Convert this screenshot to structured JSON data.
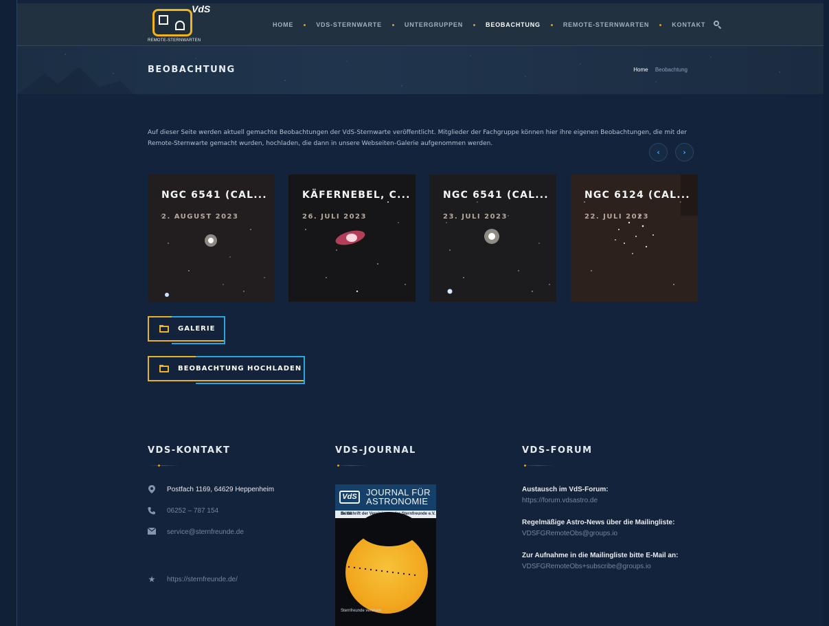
{
  "header": {
    "logo_brand": "VdS",
    "logo_text": "REMOTE-STERNWARTEN",
    "nav": [
      {
        "label": "HOME",
        "active": false
      },
      {
        "label": "VDS-STERNWARTE",
        "active": false
      },
      {
        "label": "UNTERGRUPPEN",
        "active": false
      },
      {
        "label": "BEOBACHTUNG",
        "active": true
      },
      {
        "label": "REMOTE-STERNWARTEN",
        "active": false
      },
      {
        "label": "KONTAKT",
        "active": false
      }
    ],
    "search_icon": "search-icon"
  },
  "title_band": {
    "title": "BEOBACHTUNG",
    "breadcrumb_home": "Home",
    "breadcrumb_current": "Beobachtung"
  },
  "intro": "Auf dieser Seite werden aktuell gemachte Beobachtungen der VdS-Sternwarte veröffentlicht. Mitglieder der Fachgruppe können hier ihre eigenen Beobachtungen, die mit der Remote-Sternwarte gemacht wurden, hochladen, die dann in unsere Webseiten-Galerie aufgenommen werden.",
  "carousel": {
    "prev": "‹",
    "next": "›",
    "cards": [
      {
        "title": "NGC 6541 (CAL...",
        "date": "2. AUGUST 2023"
      },
      {
        "title": "KÄFERNEBEL, C...",
        "date": "26. JULI 2023"
      },
      {
        "title": "NGC 6541 (CAL...",
        "date": "23. JULI 2023"
      },
      {
        "title": "NGC 6124 (CAL...",
        "date": "22. JULI 2023"
      }
    ]
  },
  "buttons": {
    "gallery": "GALERIE",
    "upload": "BEOBACHTUNG HOCHLADEN"
  },
  "footer": {
    "contact": {
      "heading": "VDS-KONTAKT",
      "address": "Postfach 1169, 64629 Heppenheim",
      "phone": "06252 – 787 154",
      "email": "service@sternfreunde.de",
      "website": "https://sternfreunde.de/"
    },
    "journal": {
      "heading": "VDS-JOURNAL",
      "cover_badge": "VdS",
      "cover_title_1": "JOURNAL FÜR",
      "cover_title_2": "ASTRONOMIE",
      "cover_issue": "Nr. 80",
      "cover_subtitle": "Zeitschrift der Vereinigung der Sternfreunde e.V.",
      "cover_footer": "Sternfreunde vereisen"
    },
    "forum": {
      "heading": "VDS-FORUM",
      "items": [
        {
          "label": "Austausch im VdS-Forum:",
          "link": "https://forum.vdsastro.de"
        },
        {
          "label": "Regelmäßige Astro-News über die Mailingliste:",
          "link": "VDSFGRemoteObs@groups.io"
        },
        {
          "label": "Zur Aufnahme in die Mailingliste bitte E-Mail an:",
          "link": "VDSFGRemoteObs+subscribe@groups.io"
        }
      ]
    }
  }
}
